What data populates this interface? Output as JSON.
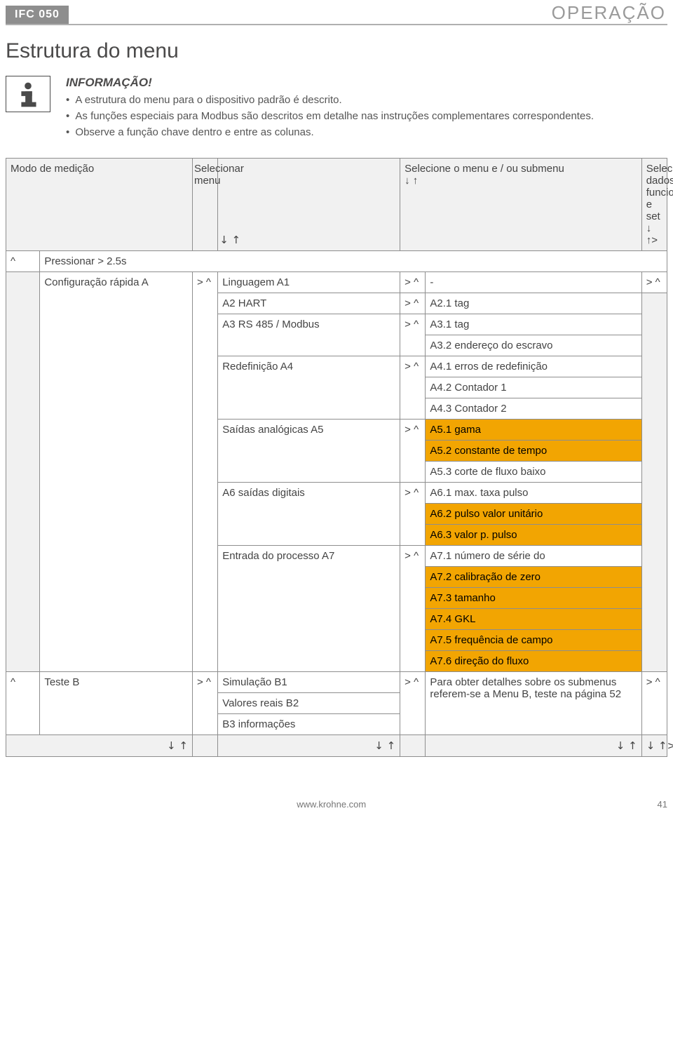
{
  "doc_id": "IFC 050",
  "section": "OPERAÇÃO",
  "page_title": "Estrutura do menu",
  "info": {
    "head": "INFORMAÇÃO!",
    "b1": "A estrutura do menu para o dispositivo padrão é descrito.",
    "b2": "As funções especiais para Modbus são descritos em detalhe nas instruções complementares correspondentes.",
    "b3": "Observe a função chave dentro e entre as colunas."
  },
  "hdr": {
    "c1_2": "Modo de medição",
    "c3": "Selecionar menu",
    "c3_arrows": "↓\n↑",
    "c4": "Selecione o menu e / ou submenu",
    "c4_arrows": "↓ ↑",
    "c7": "Selecionar dados funcionais e set",
    "c7_arrows": "↓ ↑>"
  },
  "press": {
    "label": "Pressionar > 2.5s",
    "caret": "^"
  },
  "nav": "> ^",
  "arrows_row": {
    "left": "↓ ↑",
    "right": "↓ ↑>"
  },
  "a": {
    "group": "Configuração rápida  A",
    "a1": {
      "l": "Linguagem A1",
      "r": "-"
    },
    "a2": {
      "l": "A2 HART",
      "r": "A2.1 tag"
    },
    "a3": {
      "l": "A3 RS 485 / Modbus",
      "r1": "A3.1 tag",
      "r2": "A3.2 endereço do escravo"
    },
    "a4": {
      "l": "Redefinição A4",
      "r1": "A4.1 erros de redefinição",
      "r2": "A4.2 Contador 1",
      "r3": "A4.3 Contador 2"
    },
    "a5": {
      "l": "Saídas analógicas A5",
      "r1": "A5.1 gama",
      "r2": "A5.2 constante de tempo",
      "r3": "A5.3 corte de fluxo baixo"
    },
    "a6": {
      "l": "A6 saídas digitais",
      "r1": "A6.1 max. taxa pulso",
      "r2": "A6.2 pulso valor unitário",
      "r3": "A6.3 valor p. pulso"
    },
    "a7": {
      "l": "Entrada do processo A7",
      "r1": "A7.1 número de série do",
      "r2": "A7.2 calibração de zero",
      "r3": "A7.3 tamanho",
      "r4": "A7.4 GKL",
      "r5": "A7.5 frequência de campo",
      "r6": "A7.6 direção do fluxo"
    }
  },
  "b": {
    "group": "Teste B",
    "b1": "Simulação B1",
    "b2": "Valores reais B2",
    "b3": "B3 informações",
    "note": "Para obter detalhes sobre os submenus referem-se a Menu B, teste na página 52"
  },
  "footer": {
    "url": "www.krohne.com",
    "page": "41"
  }
}
